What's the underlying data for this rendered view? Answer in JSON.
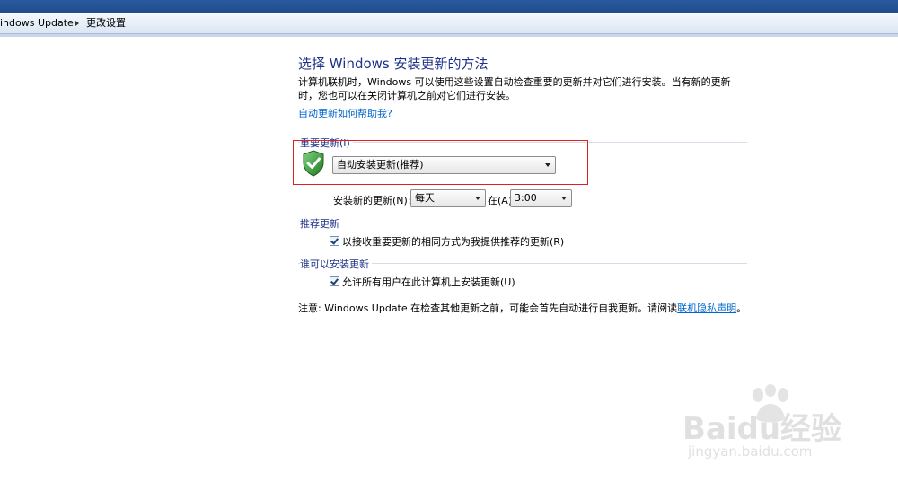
{
  "breadcrumb": {
    "item1": "indows Update",
    "item2": "更改设置"
  },
  "page": {
    "title": "选择 Windows 安装更新的方法",
    "intro": "计算机联机时，Windows 可以使用这些设置自动检查重要的更新并对它们进行安装。当有新的更新时，您也可以在关闭计算机之前对它们进行安装。",
    "help_link": "自动更新如何帮助我?"
  },
  "important_updates": {
    "section_label": "重要更新(I)",
    "dropdown_value": "自动安装更新(推荐)",
    "install_label": "安装新的更新(N):",
    "day_value": "每天",
    "at_label": "在(A)",
    "time_value": "3:00"
  },
  "recommended_updates": {
    "section_label": "推荐更新",
    "checkbox_label": "以接收重要更新的相同方式为我提供推荐的更新(R)",
    "checked": true
  },
  "who_can_install": {
    "section_label": "谁可以安装更新",
    "checkbox_label": "允许所有用户在此计算机上安装更新(U)",
    "checked": true
  },
  "note": {
    "text": "注意: Windows Update 在检查其他更新之前，可能会首先自动进行自我更新。请阅读",
    "link": "联机隐私声明",
    "suffix": "。"
  },
  "watermark": {
    "brand": "Baidu经验",
    "url": "jingyan.baidu.com"
  },
  "colors": {
    "heading": "#1e3287",
    "link": "#0066cc",
    "highlight": "#e02020",
    "shield_green": "#3aa33a"
  }
}
